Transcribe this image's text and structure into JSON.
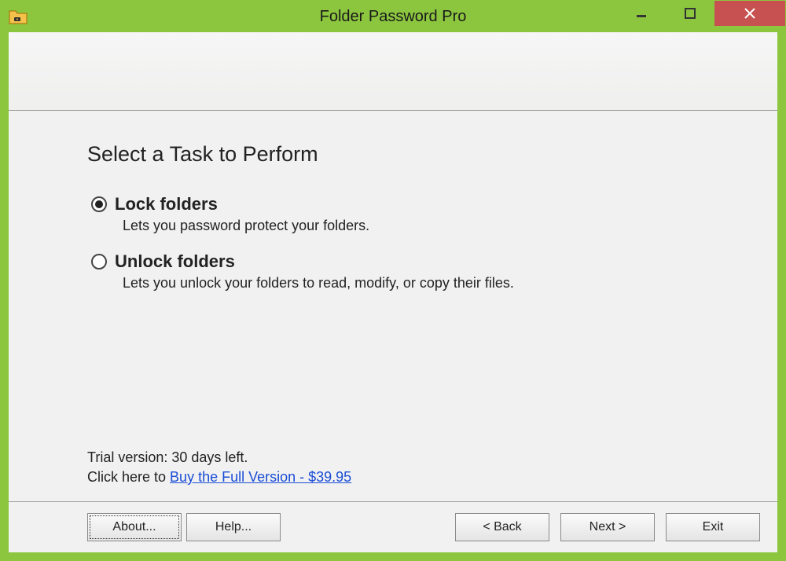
{
  "window": {
    "title": "Folder Password Pro"
  },
  "main": {
    "heading": "Select a Task to Perform",
    "options": [
      {
        "label": "Lock folders",
        "description": "Lets you password protect your folders.",
        "selected": true
      },
      {
        "label": "Unlock folders",
        "description": "Lets you unlock your folders to read, modify, or copy their files.",
        "selected": false
      }
    ],
    "trial_line": "Trial version: 30 days left.",
    "buy_prefix": "Click here to ",
    "buy_link": "Buy the Full Version - $39.95"
  },
  "buttons": {
    "about": "About...",
    "help": "Help...",
    "back": "< Back",
    "next": "Next >",
    "exit": "Exit"
  }
}
